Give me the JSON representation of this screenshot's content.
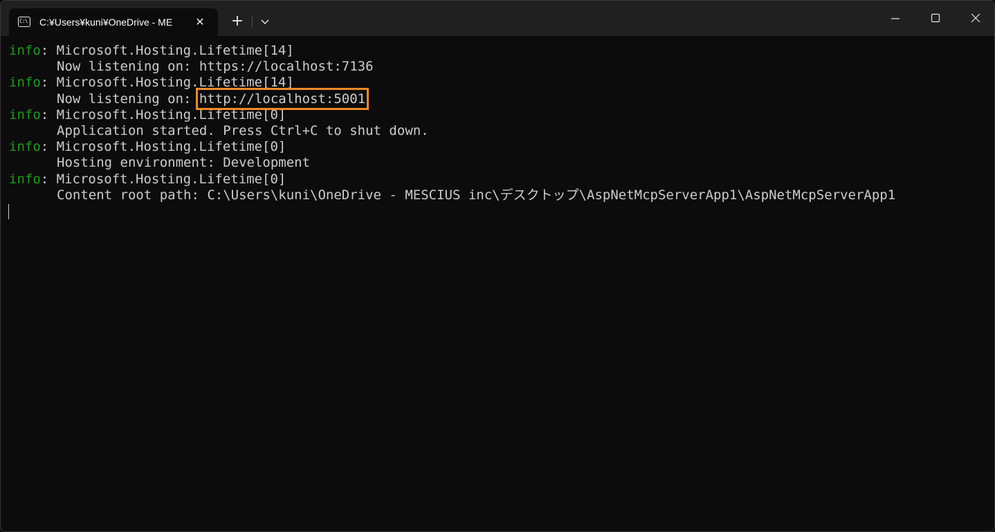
{
  "tab": {
    "icon_text": "C:\\",
    "title": "C:¥Users¥kuni¥OneDrive - ME",
    "close_glyph": "✕"
  },
  "toolbar": {
    "new_tab_glyph": "+"
  },
  "colors": {
    "log_level": "#13a10e",
    "highlight_border": "#f08a24",
    "terminal_background": "#0c0c0c",
    "titlebar_background": "#202020"
  },
  "terminal": {
    "logs": [
      {
        "level": "info",
        "source": ": Microsoft.Hosting.Lifetime[14]",
        "message": "Now listening on: ",
        "value": "https://localhost:7136"
      },
      {
        "level": "info",
        "source": ": Microsoft.Hosting.Lifetime[14]",
        "message": "Now listening on: ",
        "value": "http://localhost:5001"
      },
      {
        "level": "info",
        "source": ": Microsoft.Hosting.Lifetime[0]",
        "message": "Application started. Press Ctrl+C to shut down.",
        "value": ""
      },
      {
        "level": "info",
        "source": ": Microsoft.Hosting.Lifetime[0]",
        "message": "Hosting environment: Development",
        "value": ""
      },
      {
        "level": "info",
        "source": ": Microsoft.Hosting.Lifetime[0]",
        "message": "Content root path: C:\\Users\\kuni\\OneDrive - MESCIUS inc\\デスクトップ\\AspNetMcpServerApp1\\AspNetMcpServerApp1",
        "value": ""
      }
    ]
  }
}
